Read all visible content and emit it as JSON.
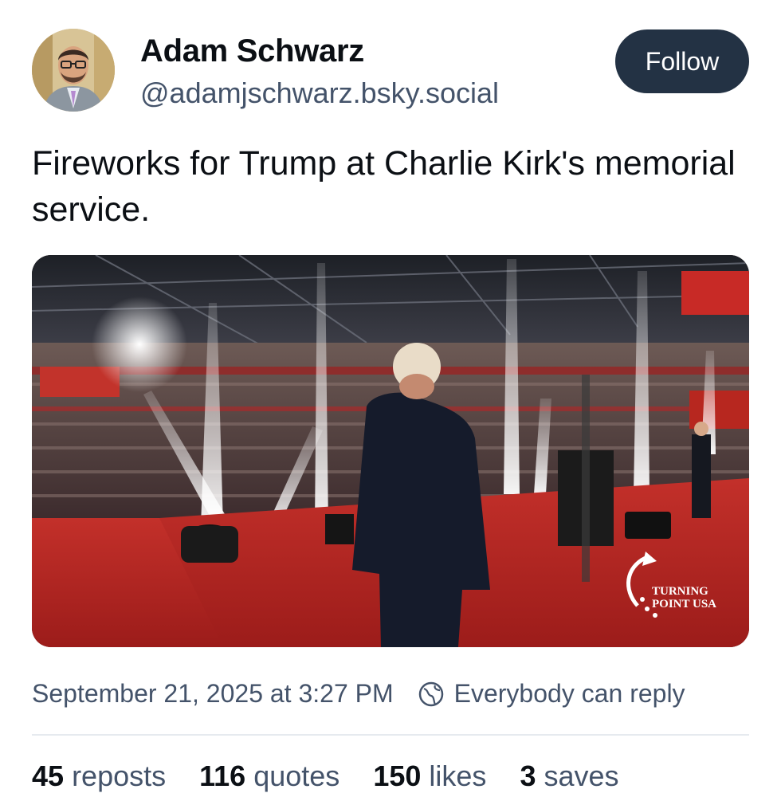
{
  "author": {
    "display_name": "Adam Schwarz",
    "handle": "@adamjschwarz.bsky.social"
  },
  "follow_button": {
    "label": "Follow"
  },
  "post": {
    "text": "Fireworks for Trump at Charlie Kirk's memorial service.",
    "image": {
      "watermark_line1": "TURNING",
      "watermark_line2": "POINT USA"
    }
  },
  "meta": {
    "timestamp": "September 21, 2025 at 3:27 PM",
    "reply_setting": "Everybody can reply"
  },
  "stats": [
    {
      "count": "45",
      "label": "reposts"
    },
    {
      "count": "116",
      "label": "quotes"
    },
    {
      "count": "150",
      "label": "likes"
    },
    {
      "count": "3",
      "label": "saves"
    }
  ],
  "colors": {
    "follow_bg": "#233244",
    "secondary_text": "#44536a",
    "stage_red": "#b8221f"
  }
}
